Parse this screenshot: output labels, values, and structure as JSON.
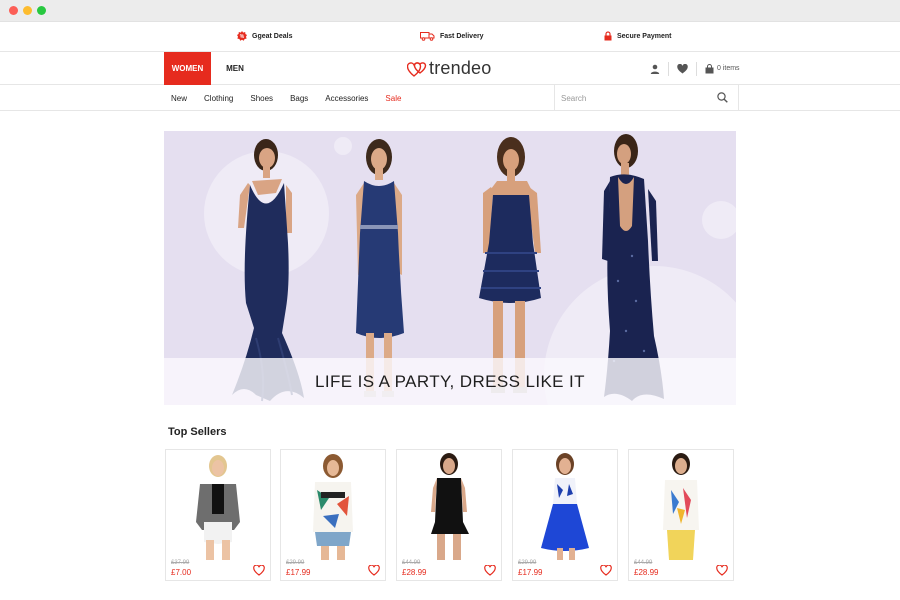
{
  "promo": [
    {
      "label": "Ggeat Deals",
      "icon": "deal-badge-icon"
    },
    {
      "label": "Fast Delivery",
      "icon": "truck-icon"
    },
    {
      "label": "Secure Payment",
      "icon": "lock-icon"
    }
  ],
  "header": {
    "women_label": "WOMEN",
    "men_label": "MEN",
    "logo_text": "trendeo",
    "cart_label": "0 items"
  },
  "nav": {
    "items": [
      "New",
      "Clothing",
      "Shoes",
      "Bags",
      "Accessories",
      "Sale"
    ],
    "search_placeholder": "Search"
  },
  "hero": {
    "tagline": "LIFE IS A PARTY, DRESS LIKE IT"
  },
  "top_sellers": {
    "title": "Top Sellers",
    "products": [
      {
        "old_price": "£37.99",
        "price": "£7.00"
      },
      {
        "old_price": "£29.99",
        "price": "£17.99"
      },
      {
        "old_price": "£44.99",
        "price": "£28.99"
      },
      {
        "old_price": "£29.99",
        "price": "£17.99"
      },
      {
        "old_price": "£44.99",
        "price": "£28.99"
      }
    ]
  },
  "colors": {
    "accent": "#e62b1e",
    "hero_background": "#e5dff0",
    "dress_navy": "#1d2b57"
  }
}
